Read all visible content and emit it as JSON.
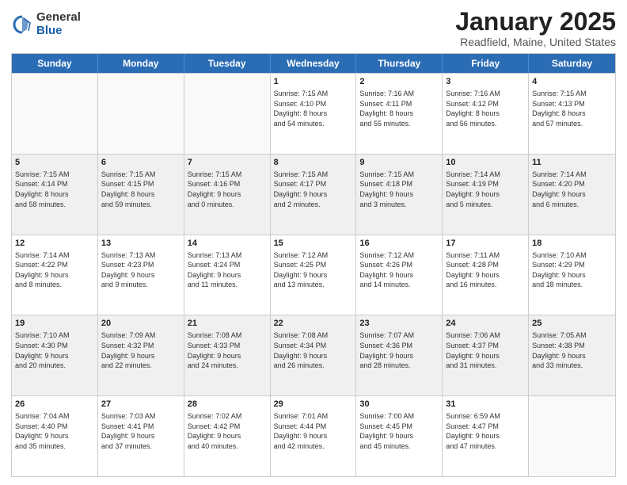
{
  "logo": {
    "general": "General",
    "blue": "Blue"
  },
  "header": {
    "month": "January 2025",
    "location": "Readfield, Maine, United States"
  },
  "weekdays": [
    "Sunday",
    "Monday",
    "Tuesday",
    "Wednesday",
    "Thursday",
    "Friday",
    "Saturday"
  ],
  "rows": [
    [
      {
        "day": "",
        "info": ""
      },
      {
        "day": "",
        "info": ""
      },
      {
        "day": "",
        "info": ""
      },
      {
        "day": "1",
        "info": "Sunrise: 7:15 AM\nSunset: 4:10 PM\nDaylight: 8 hours\nand 54 minutes."
      },
      {
        "day": "2",
        "info": "Sunrise: 7:16 AM\nSunset: 4:11 PM\nDaylight: 8 hours\nand 55 minutes."
      },
      {
        "day": "3",
        "info": "Sunrise: 7:16 AM\nSunset: 4:12 PM\nDaylight: 8 hours\nand 56 minutes."
      },
      {
        "day": "4",
        "info": "Sunrise: 7:15 AM\nSunset: 4:13 PM\nDaylight: 8 hours\nand 57 minutes."
      }
    ],
    [
      {
        "day": "5",
        "info": "Sunrise: 7:15 AM\nSunset: 4:14 PM\nDaylight: 8 hours\nand 58 minutes."
      },
      {
        "day": "6",
        "info": "Sunrise: 7:15 AM\nSunset: 4:15 PM\nDaylight: 8 hours\nand 59 minutes."
      },
      {
        "day": "7",
        "info": "Sunrise: 7:15 AM\nSunset: 4:16 PM\nDaylight: 9 hours\nand 0 minutes."
      },
      {
        "day": "8",
        "info": "Sunrise: 7:15 AM\nSunset: 4:17 PM\nDaylight: 9 hours\nand 2 minutes."
      },
      {
        "day": "9",
        "info": "Sunrise: 7:15 AM\nSunset: 4:18 PM\nDaylight: 9 hours\nand 3 minutes."
      },
      {
        "day": "10",
        "info": "Sunrise: 7:14 AM\nSunset: 4:19 PM\nDaylight: 9 hours\nand 5 minutes."
      },
      {
        "day": "11",
        "info": "Sunrise: 7:14 AM\nSunset: 4:20 PM\nDaylight: 9 hours\nand 6 minutes."
      }
    ],
    [
      {
        "day": "12",
        "info": "Sunrise: 7:14 AM\nSunset: 4:22 PM\nDaylight: 9 hours\nand 8 minutes."
      },
      {
        "day": "13",
        "info": "Sunrise: 7:13 AM\nSunset: 4:23 PM\nDaylight: 9 hours\nand 9 minutes."
      },
      {
        "day": "14",
        "info": "Sunrise: 7:13 AM\nSunset: 4:24 PM\nDaylight: 9 hours\nand 11 minutes."
      },
      {
        "day": "15",
        "info": "Sunrise: 7:12 AM\nSunset: 4:25 PM\nDaylight: 9 hours\nand 13 minutes."
      },
      {
        "day": "16",
        "info": "Sunrise: 7:12 AM\nSunset: 4:26 PM\nDaylight: 9 hours\nand 14 minutes."
      },
      {
        "day": "17",
        "info": "Sunrise: 7:11 AM\nSunset: 4:28 PM\nDaylight: 9 hours\nand 16 minutes."
      },
      {
        "day": "18",
        "info": "Sunrise: 7:10 AM\nSunset: 4:29 PM\nDaylight: 9 hours\nand 18 minutes."
      }
    ],
    [
      {
        "day": "19",
        "info": "Sunrise: 7:10 AM\nSunset: 4:30 PM\nDaylight: 9 hours\nand 20 minutes."
      },
      {
        "day": "20",
        "info": "Sunrise: 7:09 AM\nSunset: 4:32 PM\nDaylight: 9 hours\nand 22 minutes."
      },
      {
        "day": "21",
        "info": "Sunrise: 7:08 AM\nSunset: 4:33 PM\nDaylight: 9 hours\nand 24 minutes."
      },
      {
        "day": "22",
        "info": "Sunrise: 7:08 AM\nSunset: 4:34 PM\nDaylight: 9 hours\nand 26 minutes."
      },
      {
        "day": "23",
        "info": "Sunrise: 7:07 AM\nSunset: 4:36 PM\nDaylight: 9 hours\nand 28 minutes."
      },
      {
        "day": "24",
        "info": "Sunrise: 7:06 AM\nSunset: 4:37 PM\nDaylight: 9 hours\nand 31 minutes."
      },
      {
        "day": "25",
        "info": "Sunrise: 7:05 AM\nSunset: 4:38 PM\nDaylight: 9 hours\nand 33 minutes."
      }
    ],
    [
      {
        "day": "26",
        "info": "Sunrise: 7:04 AM\nSunset: 4:40 PM\nDaylight: 9 hours\nand 35 minutes."
      },
      {
        "day": "27",
        "info": "Sunrise: 7:03 AM\nSunset: 4:41 PM\nDaylight: 9 hours\nand 37 minutes."
      },
      {
        "day": "28",
        "info": "Sunrise: 7:02 AM\nSunset: 4:42 PM\nDaylight: 9 hours\nand 40 minutes."
      },
      {
        "day": "29",
        "info": "Sunrise: 7:01 AM\nSunset: 4:44 PM\nDaylight: 9 hours\nand 42 minutes."
      },
      {
        "day": "30",
        "info": "Sunrise: 7:00 AM\nSunset: 4:45 PM\nDaylight: 9 hours\nand 45 minutes."
      },
      {
        "day": "31",
        "info": "Sunrise: 6:59 AM\nSunset: 4:47 PM\nDaylight: 9 hours\nand 47 minutes."
      },
      {
        "day": "",
        "info": ""
      }
    ]
  ]
}
